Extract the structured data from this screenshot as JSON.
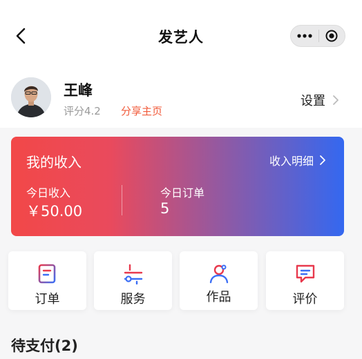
{
  "nav": {
    "title": "发艺人",
    "back_icon": "chevron-left-icon",
    "more_icon": "more-dots-icon",
    "close_icon": "capsule-close-icon"
  },
  "profile": {
    "name": "王峰",
    "rating": "评分4.2",
    "share_label": "分享主页",
    "settings_label": "设置",
    "avatar_icon": "avatar-photo"
  },
  "income": {
    "title": "我的收入",
    "detail_label": "收入明细",
    "today_income_label": "今日收入",
    "today_income_value": "￥50.00",
    "today_orders_label": "今日订单",
    "today_orders_value": "5",
    "gradient": [
      "#f24848",
      "#e94a5d",
      "#8d5aa6",
      "#3468f0"
    ]
  },
  "shortcuts": [
    {
      "label": "订单",
      "icon": "order-doc-icon"
    },
    {
      "label": "服务",
      "icon": "service-slider-icon"
    },
    {
      "label": "作品",
      "icon": "works-person-icon"
    },
    {
      "label": "评价",
      "icon": "review-chat-icon"
    }
  ],
  "section": {
    "title": "待支付(2)"
  },
  "colors": {
    "accent_red": "#f15a3a",
    "icon_red": "#e8394d",
    "icon_blue": "#3b6ef5"
  }
}
